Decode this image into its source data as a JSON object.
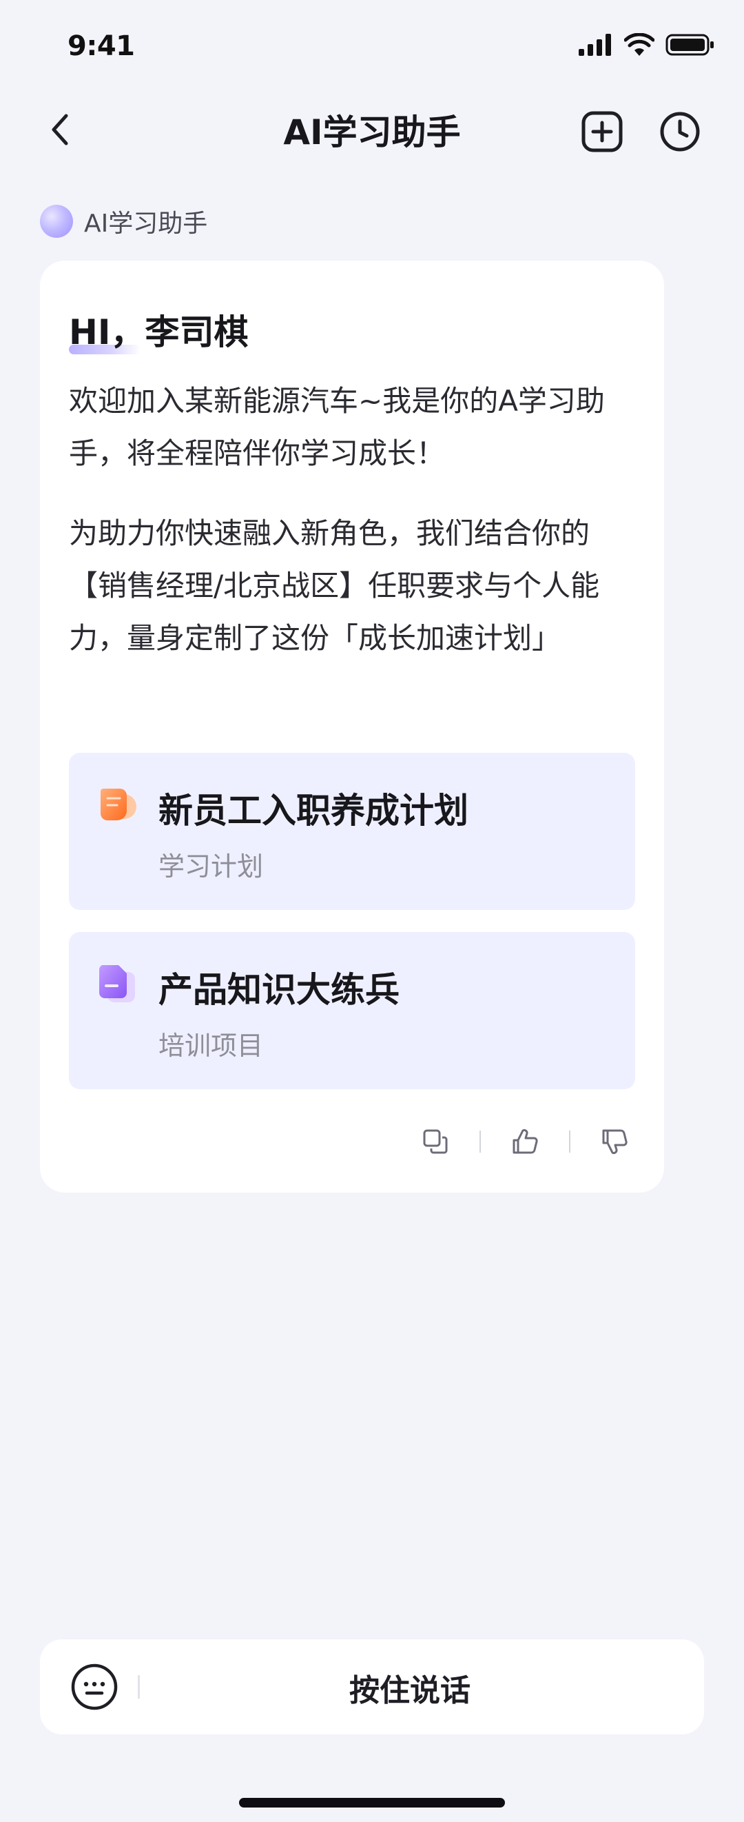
{
  "status_bar": {
    "time": "9:41"
  },
  "nav": {
    "title": "AI学习助手"
  },
  "assistant": {
    "name": "AI学习助手"
  },
  "message": {
    "greeting": "HI，李司棋",
    "paragraphs": [
      "欢迎加入某新能源汽车~我是你的A学习助手，将全程陪伴你学习成长！",
      "为助力你快速融入新角色，我们结合你的【销售经理/北京战区】任职要求与个人能力，量身定制了这份「成长加速计划」"
    ],
    "items": [
      {
        "title": "新员工入职养成计划",
        "subtitle": "学习计划",
        "icon": "learning-plan-icon",
        "color": "#FF8A3D"
      },
      {
        "title": "产品知识大练兵",
        "subtitle": "培训项目",
        "icon": "training-document-icon",
        "color": "#9C6BFF"
      }
    ],
    "actions": [
      "copy-icon",
      "thumbs-up-icon",
      "thumbs-down-icon"
    ]
  },
  "input": {
    "hold_to_talk": "按住说话",
    "keyboard_icon": "keyboard-icon"
  },
  "colors": {
    "background": "#F3F3FA",
    "card": "#FFFFFF",
    "item_card": "#EFF0FF",
    "accent": "#9C8FFF"
  }
}
